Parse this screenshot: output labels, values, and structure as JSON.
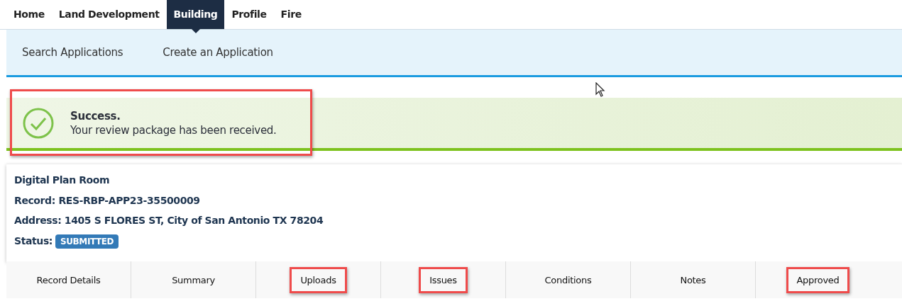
{
  "top_nav": [
    {
      "label": "Home",
      "selected": false
    },
    {
      "label": "Land Development",
      "selected": false
    },
    {
      "label": "Building",
      "selected": true
    },
    {
      "label": "Profile",
      "selected": false
    },
    {
      "label": "Fire",
      "selected": false
    }
  ],
  "sub_nav": [
    "Search Applications",
    "Create an Application"
  ],
  "alert": {
    "kind": "success",
    "title": "Success.",
    "message": "Your review package has been received.",
    "highlighted": true
  },
  "record": {
    "title": "Digital Plan Room",
    "record": "Record: RES-RBP-APP23-35500009",
    "address": "Address: 1405 S FLORES ST, City of San Antonio TX 78204",
    "status_label": "Status:",
    "status": "SUBMITTED"
  },
  "tabs": [
    {
      "label": "Record Details",
      "highlighted": false
    },
    {
      "label": "Summary",
      "highlighted": false
    },
    {
      "label": "Uploads",
      "highlighted": true
    },
    {
      "label": "Issues",
      "highlighted": true
    },
    {
      "label": "Conditions",
      "highlighted": false
    },
    {
      "label": "Notes",
      "highlighted": false
    },
    {
      "label": "Approved",
      "highlighted": true
    }
  ]
}
